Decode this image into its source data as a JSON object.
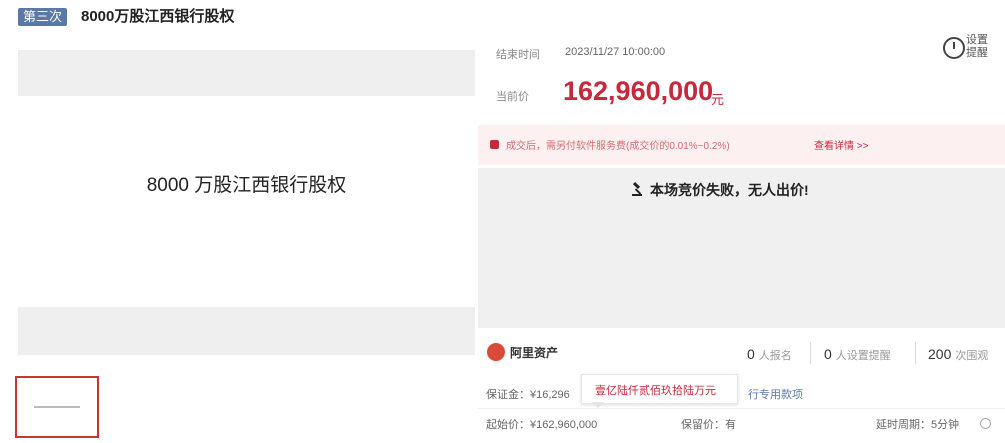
{
  "header": {
    "round_badge": "第三次",
    "title": "8000万股江西银行股权"
  },
  "gallery": {
    "main_caption": "8000 万股江西银行股权"
  },
  "auction": {
    "end_label": "结束时间",
    "end_value": "2023/11/27 10:00:00",
    "price_label": "当前价",
    "price_value": "162,960,000",
    "price_unit": "元",
    "remind_label": "设置提醒"
  },
  "notice": {
    "text": "成交后，需另付软件服务费(成交价的0.01%~0.2%)",
    "link": "查看详情 >>"
  },
  "status": {
    "text": "本场竞价失败，无人出价!"
  },
  "brand": {
    "name": "阿里资产"
  },
  "stats": [
    {
      "value": "0",
      "label": "人报名"
    },
    {
      "value": "0",
      "label": "人设置提醒"
    },
    {
      "value": "200",
      "label": "次围观"
    }
  ],
  "info": {
    "deposit": "保证金：¥16,296",
    "special": "行专用款项",
    "start_price": "起始价：¥162,960,000",
    "reserve": "保留价：有",
    "delay": "延时周期：5分钟"
  },
  "tooltip": {
    "text": "壹亿陆仟贰佰玖拾陆万元"
  },
  "colors": {
    "accent": "#c8283c",
    "badge": "#5a79a8",
    "notice_bg": "#fdf0f0"
  }
}
